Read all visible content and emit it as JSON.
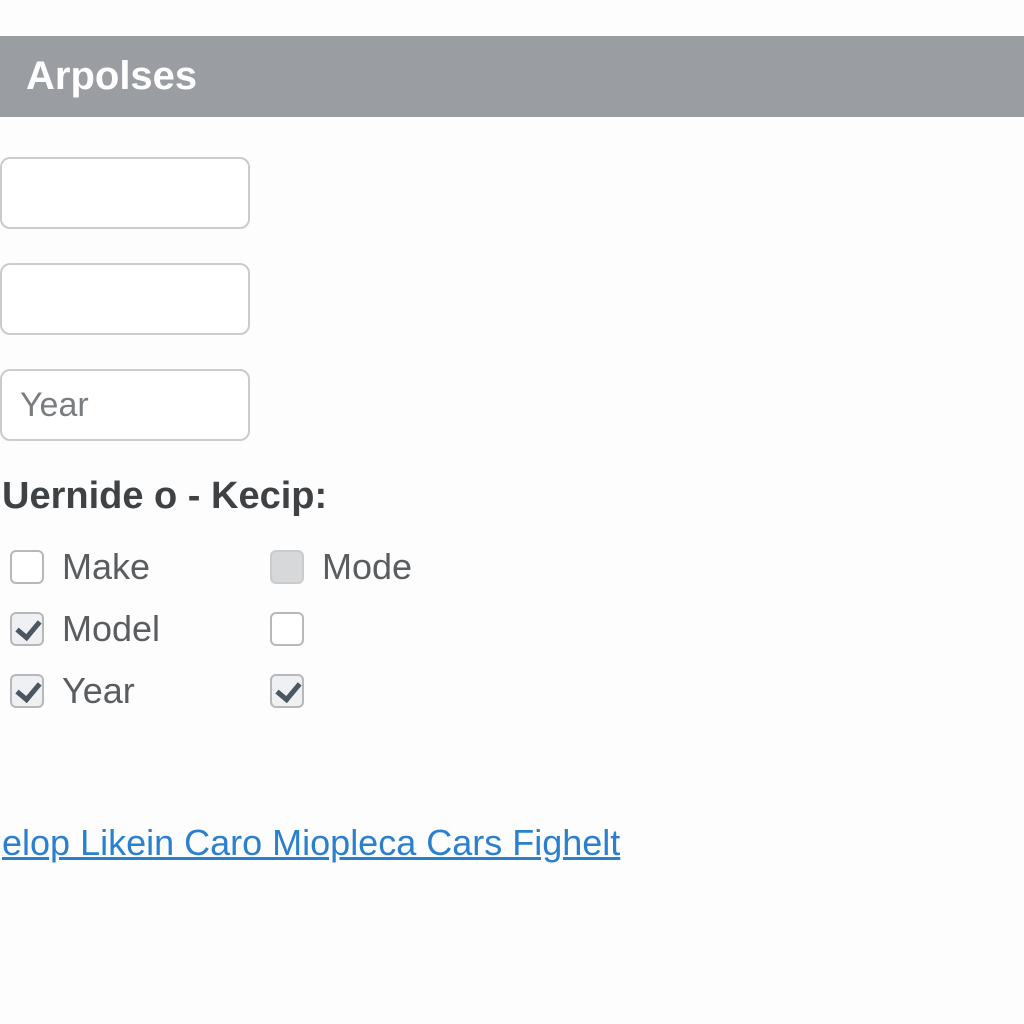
{
  "header": {
    "title": "Arpolses"
  },
  "form": {
    "input1_value": "",
    "input2_value": "",
    "input3_placeholder": "Year",
    "input3_value": ""
  },
  "checkboxes": {
    "section_label": "Uernide o - Kecip:",
    "row1": {
      "a_label": "Make",
      "a_checked": false,
      "b_label": "Mode",
      "b_disabled": true
    },
    "row2": {
      "a_label": "Model",
      "a_checked": true,
      "b_label": "",
      "b_checked": false
    },
    "row3": {
      "a_label": "Year",
      "a_checked": true,
      "b_label": "",
      "b_checked": true
    }
  },
  "footer": {
    "link_text": "elop Likein Caro Miopleca Cars Fighelt"
  }
}
